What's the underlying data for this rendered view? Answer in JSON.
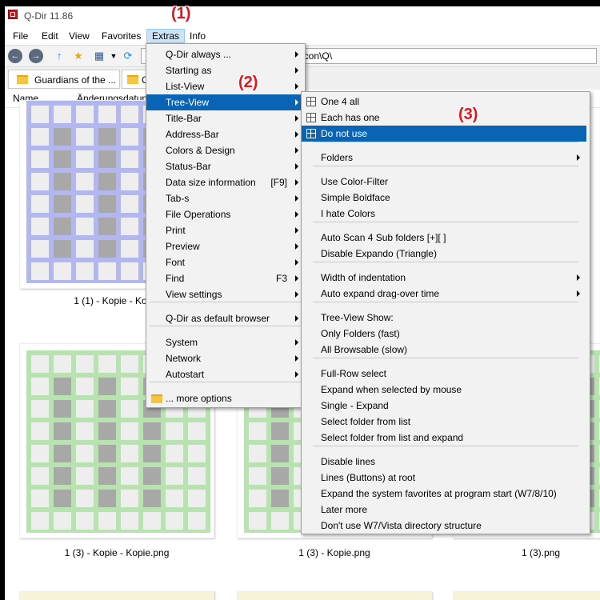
{
  "window": {
    "title": "Q-Dir 11.86"
  },
  "menubar": {
    "items": [
      "File",
      "Edit",
      "View",
      "Favorites",
      "Extras",
      "Info"
    ],
    "active": "Extras"
  },
  "address": {
    "value": "g\\icon\\Q\\"
  },
  "tabs": [
    {
      "label": "Guardians of the ..."
    },
    {
      "label": "C"
    }
  ],
  "columns": {
    "name": "Name",
    "date": "Änderungsdatum"
  },
  "files": [
    {
      "caption": "1 (1) - Kopie - Kopie"
    },
    {
      "caption": "1 (3) - Kopie - Kopie.png"
    },
    {
      "caption": "1 (3) - Kopie.png"
    },
    {
      "caption": "1 (3).png"
    }
  ],
  "colors": {
    "highlight": "#0a64b6",
    "annotation": "#e0141e",
    "grid_blue": "#b3b7f0",
    "grid_green": "#b8e3b0"
  },
  "extras_menu": {
    "items": [
      {
        "label": "Q-Dir always ...",
        "submenu": true
      },
      {
        "label": "Starting as",
        "submenu": true
      },
      {
        "label": "List-View",
        "submenu": true
      },
      {
        "label": "Tree-View",
        "submenu": true,
        "highlighted": true
      },
      {
        "label": "Title-Bar",
        "submenu": true
      },
      {
        "label": "Address-Bar",
        "submenu": true
      },
      {
        "label": "Colors & Design",
        "submenu": true
      },
      {
        "label": "Status-Bar",
        "submenu": true
      },
      {
        "label": "Data size information",
        "shortcut": "[F9]",
        "submenu": true
      },
      {
        "label": "Tab-s",
        "submenu": true
      },
      {
        "label": "File Operations",
        "submenu": true
      },
      {
        "label": "Print",
        "submenu": true
      },
      {
        "label": "Preview",
        "submenu": true
      },
      {
        "label": "Font",
        "submenu": true
      },
      {
        "label": "Find",
        "shortcut": "F3",
        "submenu": true
      },
      {
        "label": "View settings",
        "submenu": true
      },
      {
        "label": "Q-Dir as default browser",
        "submenu": true
      },
      {
        "label": "System",
        "submenu": true
      },
      {
        "label": "Network",
        "submenu": true
      },
      {
        "label": "Autostart",
        "submenu": true
      },
      {
        "label": "... more options",
        "icon": "folder-icon"
      }
    ]
  },
  "treeview_menu": {
    "items": [
      {
        "label": "One 4 all",
        "icon": "tree-icon"
      },
      {
        "label": "Each has one",
        "icon": "tree-icon"
      },
      {
        "label": "Do not use",
        "icon": "tree-icon",
        "highlighted": true
      },
      {
        "label": "Folders",
        "submenu": true
      },
      {
        "label": "Use Color-Filter"
      },
      {
        "label": "Simple Boldface"
      },
      {
        "label": "I hate Colors"
      },
      {
        "label": "Auto Scan 4 Sub folders  [+][ ]"
      },
      {
        "label": "Disable Expando (Triangle)"
      },
      {
        "label": "Width of indentation",
        "submenu": true
      },
      {
        "label": "Auto expand drag-over time",
        "submenu": true
      },
      {
        "label": "Tree-View Show:"
      },
      {
        "label": "Only Folders (fast)"
      },
      {
        "label": "All Browsable (slow)"
      },
      {
        "label": "Full-Row select"
      },
      {
        "label": "Expand when selected by mouse"
      },
      {
        "label": "Single - Expand"
      },
      {
        "label": "Select folder from list"
      },
      {
        "label": "Select folder from list and expand"
      },
      {
        "label": "Disable lines"
      },
      {
        "label": "Lines (Buttons) at root"
      },
      {
        "label": "Expand the system favorites at program start (W7/8/10)"
      },
      {
        "label": "Later more"
      },
      {
        "label": "Don't use W7/Vista directory structure"
      }
    ]
  },
  "annotations": [
    "(1)",
    "(2)",
    "(3)"
  ]
}
